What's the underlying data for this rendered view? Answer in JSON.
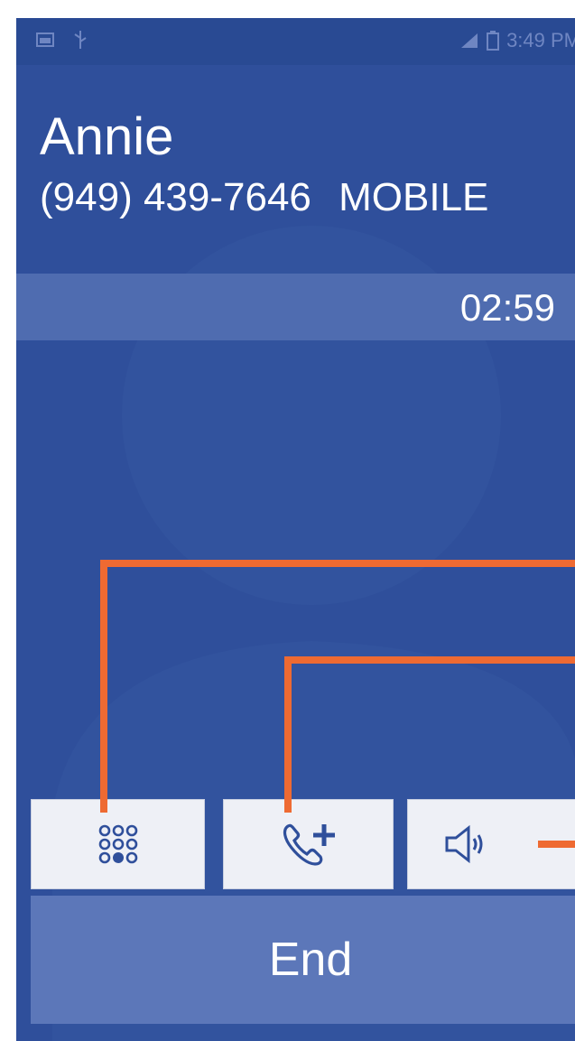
{
  "status_bar": {
    "time": "3:49 PM",
    "icons": [
      "gallery-notification-icon",
      "usb-icon",
      "signal-icon",
      "battery-icon"
    ]
  },
  "caller": {
    "name": "Annie",
    "number": "(949) 439-7646",
    "label": "MOBILE"
  },
  "call": {
    "duration": "02:59"
  },
  "controls": {
    "dialpad_icon": "dialpad-icon",
    "add_call_icon": "add-call-icon",
    "speaker_icon": "speaker-icon",
    "end_label": "End"
  },
  "colors": {
    "background": "#2f4f9b",
    "status_bar": "#294a93",
    "timer_bar": "#4f6cb0",
    "button": "#eef0f6",
    "end_button": "#5c77b9",
    "callout": "#ee6a32"
  }
}
